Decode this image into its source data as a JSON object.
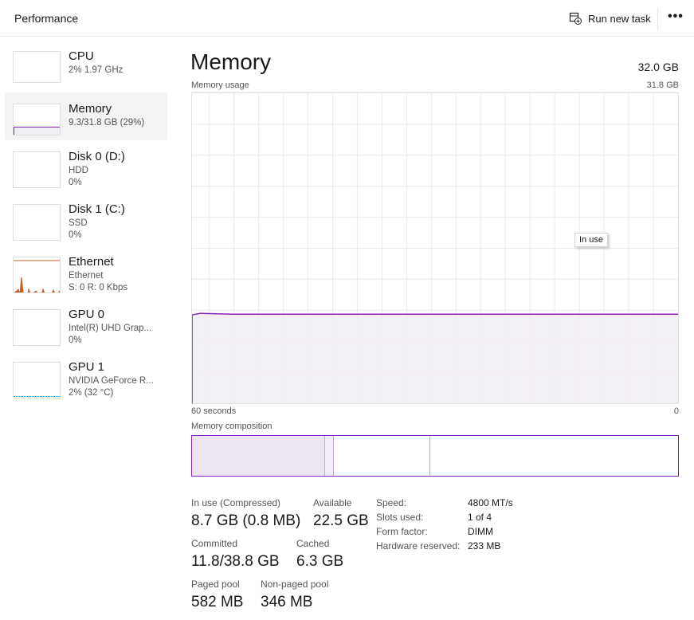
{
  "header": {
    "title": "Performance",
    "run_new_task": "Run new task",
    "more": "•••"
  },
  "sidebar": {
    "items": [
      {
        "name": "CPU",
        "lines": [
          "2%  1.97 GHz"
        ]
      },
      {
        "name": "Memory",
        "lines": [
          "9.3/31.8 GB (29%)"
        ],
        "selected": true
      },
      {
        "name": "Disk 0 (D:)",
        "lines": [
          "HDD",
          "0%"
        ]
      },
      {
        "name": "Disk 1 (C:)",
        "lines": [
          "SSD",
          "0%"
        ]
      },
      {
        "name": "Ethernet",
        "lines": [
          "Ethernet",
          "S: 0  R: 0 Kbps"
        ]
      },
      {
        "name": "GPU 0",
        "lines": [
          "Intel(R) UHD Grap...",
          "0%"
        ]
      },
      {
        "name": "GPU 1",
        "lines": [
          "NVIDIA GeForce R...",
          "2%  (32 °C)"
        ]
      }
    ]
  },
  "main": {
    "title": "Memory",
    "total": "32.0 GB",
    "usage_label": "Memory usage",
    "usage_max": "31.8 GB",
    "time_left": "60 seconds",
    "time_right": "0",
    "tooltip": "In use",
    "usage_percent": 29,
    "composition_label": "Memory composition",
    "composition_gb": {
      "in_use": 8.7,
      "modified": 0.6,
      "standby": 6.3,
      "free": 16.2
    },
    "stats": {
      "in_use_label": "In use (Compressed)",
      "in_use": "8.7 GB (0.8 MB)",
      "available_label": "Available",
      "available": "22.5 GB",
      "committed_label": "Committed",
      "committed": "11.8/38.8 GB",
      "cached_label": "Cached",
      "cached": "6.3 GB",
      "paged_label": "Paged pool",
      "paged": "582 MB",
      "nonpaged_label": "Non-paged pool",
      "nonpaged": "346 MB"
    },
    "specs": [
      {
        "k": "Speed:",
        "v": "4800 MT/s"
      },
      {
        "k": "Slots used:",
        "v": "1 of 4"
      },
      {
        "k": "Form factor:",
        "v": "DIMM"
      },
      {
        "k": "Hardware reserved:",
        "v": "233 MB"
      }
    ]
  },
  "colors": {
    "memory": "#8b22b8",
    "memory_fill": "#f1edf4",
    "ethernet": "#c1632b",
    "gpu": "#1a8fd6"
  }
}
